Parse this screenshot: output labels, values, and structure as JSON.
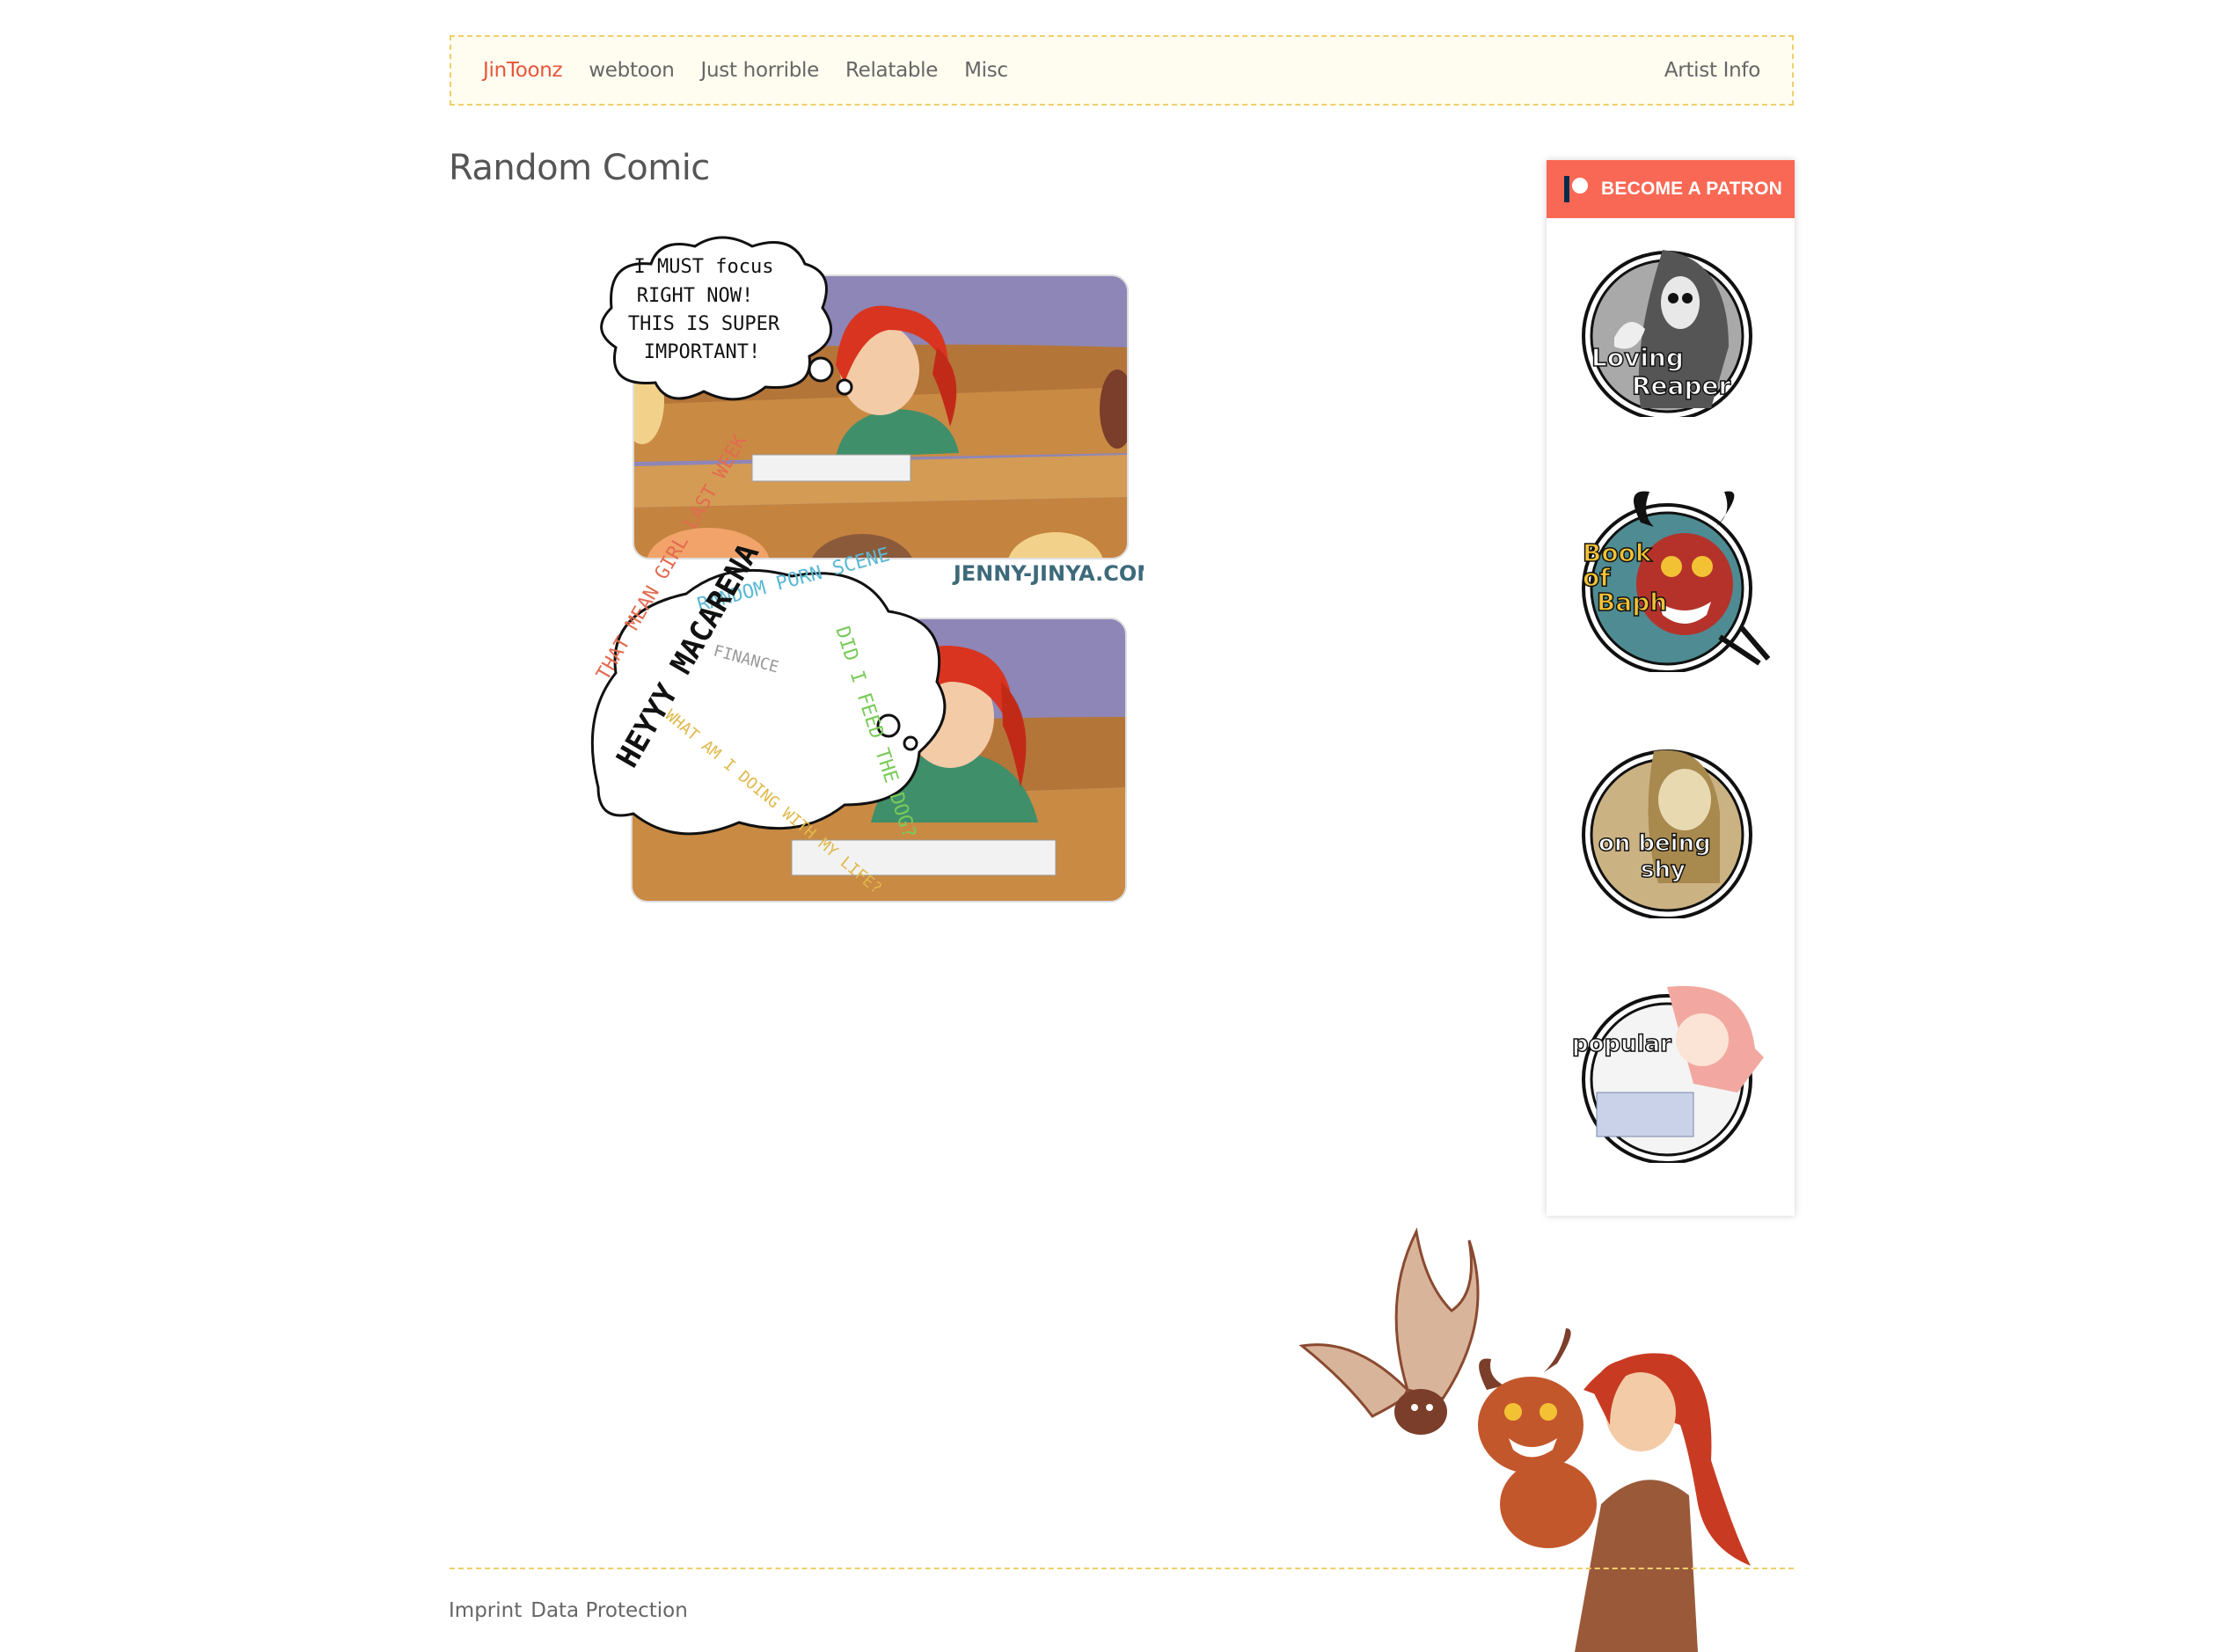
{
  "nav": {
    "items": [
      {
        "label": "JinToonz",
        "active": true
      },
      {
        "label": "webtoon"
      },
      {
        "label": "Just horrible"
      },
      {
        "label": "Relatable"
      },
      {
        "label": "Misc"
      }
    ],
    "right_link": "Artist Info"
  },
  "main": {
    "title": "Random Comic"
  },
  "comic": {
    "panel1_bubble": [
      "I MUST focus",
      "RIGHT NOW!",
      "THIS IS SUPER",
      "IMPORTANT!"
    ],
    "watermark": "JENNY-JINYA.COM",
    "panel2_thoughts": {
      "main": "HEYYY MACARENA",
      "t1": "THAT MEAN GIRL LAST WEEK",
      "t2": "RANDOM PORN SCENE",
      "t3": "DID I FEED THE DOG?",
      "t4": "WHAT AM I DOING WITH MY LIFE?",
      "t5": "FINANCE"
    }
  },
  "sidebar": {
    "patron_label": "BECOME A PATRON",
    "badges": [
      {
        "label_l1": "Loving",
        "label_l2": "Reaper"
      },
      {
        "label_l1": "Book",
        "label_l2": "of",
        "label_l3": "Baph"
      },
      {
        "label_l1": "on being",
        "label_l2": "shy"
      },
      {
        "label_l1": "popular"
      }
    ]
  },
  "footer": {
    "imprint": "Imprint",
    "data_protection": "Data Protection"
  },
  "colors": {
    "accent": "#e8553a",
    "nav_border": "#f0cf6a",
    "nav_bg": "#fffdf0",
    "patreon": "#f96854"
  }
}
